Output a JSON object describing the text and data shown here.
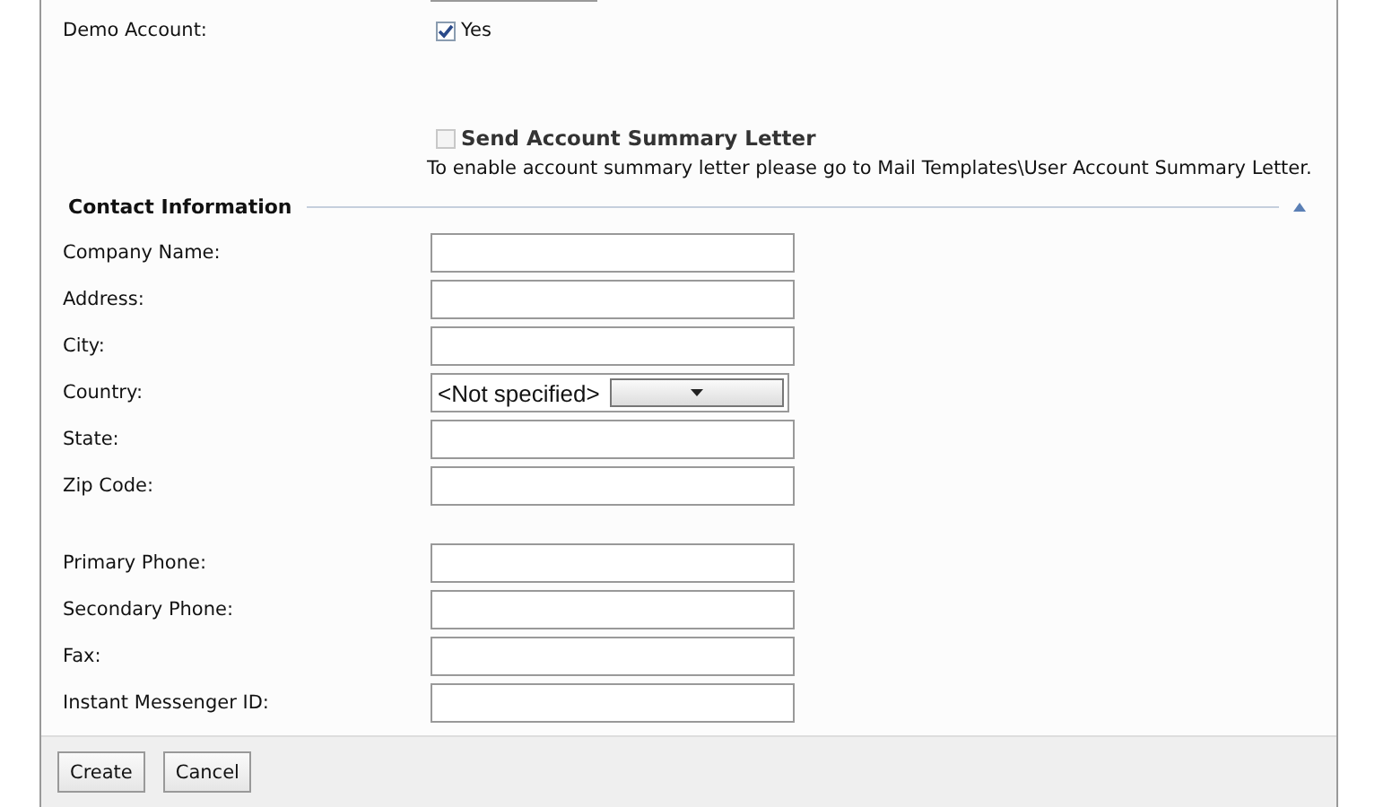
{
  "demo_account": {
    "label": "Demo Account:",
    "option": "Yes",
    "checked": true
  },
  "summary_letter": {
    "label": "Send Account Summary Letter",
    "checked": false,
    "disabled": true,
    "hint": "To enable account summary letter please go to Mail Templates\\User Account Summary Letter."
  },
  "section": {
    "title": "Contact Information",
    "expanded": true
  },
  "field_groups": [
    [
      {
        "label": "Company Name:",
        "kind": "text"
      },
      {
        "label": "Address:",
        "kind": "text"
      },
      {
        "label": "City:",
        "kind": "text"
      },
      {
        "label": "Country:",
        "kind": "select",
        "value": "<Not specified>"
      },
      {
        "label": "State:",
        "kind": "text"
      },
      {
        "label": "Zip Code:",
        "kind": "text"
      }
    ],
    [
      {
        "label": "Primary Phone:",
        "kind": "text"
      },
      {
        "label": "Secondary Phone:",
        "kind": "text"
      },
      {
        "label": "Fax:",
        "kind": "text"
      },
      {
        "label": "Instant Messenger ID:",
        "kind": "text"
      }
    ]
  ],
  "buttons": [
    "Create",
    "Cancel"
  ]
}
